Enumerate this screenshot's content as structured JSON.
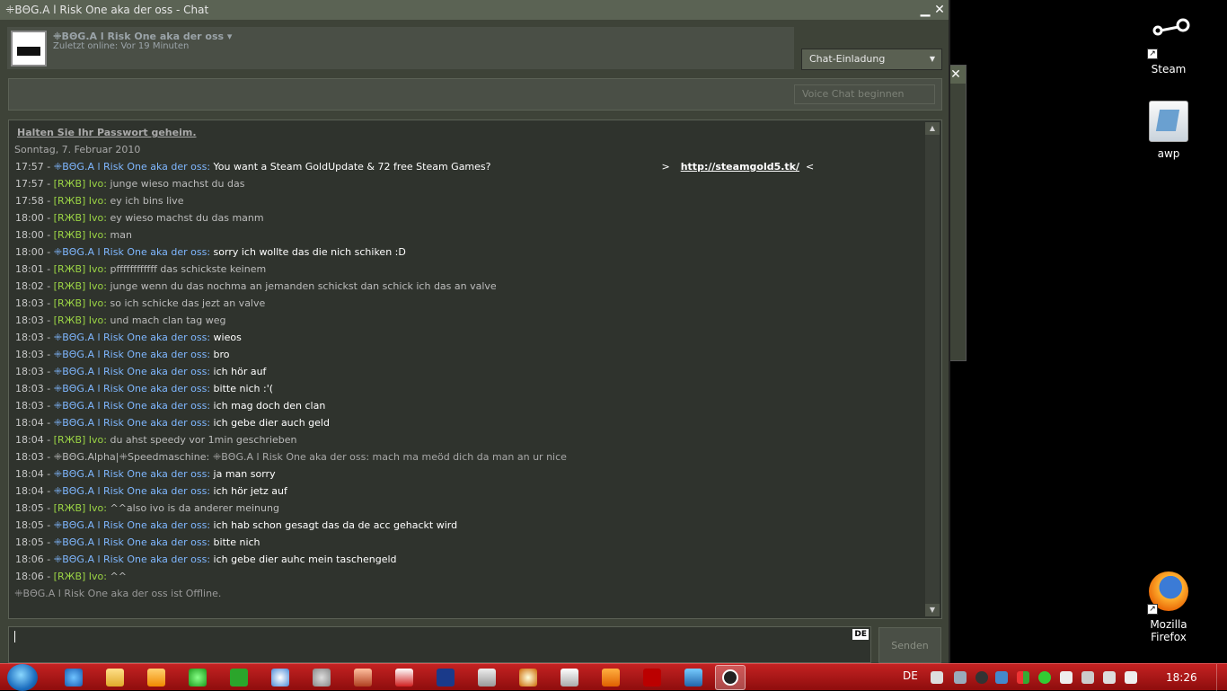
{
  "window": {
    "title": "ꔰBΘG.A l Risk One aka der oss - Chat",
    "minimize_glyph": "▁",
    "close_glyph": "✕"
  },
  "header": {
    "name": "ꔰBΘG.A l Risk One aka der oss ▾",
    "status": "Zuletzt online: Vor 19 Minuten"
  },
  "invite": {
    "label": "Chat-Einladung",
    "arrow": "▼"
  },
  "voice": {
    "label": "Voice Chat beginnen"
  },
  "log": {
    "warning": "Halten Sie Ihr Passwort geheim.",
    "date": "Sonntag, 7. Februar 2010",
    "messages": [
      {
        "time": "17:57 - ",
        "name": "ꔰBΘG.A l Risk One aka der oss",
        "sender": "self",
        "text": "You want a Steam GoldUpdate & 72 free Steam Games?",
        "link_prefix": ">",
        "link": "http://steamgold5.tk/",
        "link_suffix": "<"
      },
      {
        "time": "17:57 - ",
        "name": "[RЖB] Ivo",
        "sender": "ivo",
        "text": "junge wieso machst du das"
      },
      {
        "time": "17:58 - ",
        "name": "[RЖB] Ivo",
        "sender": "ivo",
        "text": "ey ich bins live"
      },
      {
        "time": "18:00 - ",
        "name": "[RЖB] Ivo",
        "sender": "ivo",
        "text": "ey wieso machst du das manm"
      },
      {
        "time": "18:00 - ",
        "name": "[RЖB] Ivo",
        "sender": "ivo",
        "text": "man"
      },
      {
        "time": "18:00 - ",
        "name": "ꔰBΘG.A l Risk One aka der oss",
        "sender": "self",
        "text": "sorry ich wollte das die nich schiken :D"
      },
      {
        "time": "18:01 - ",
        "name": "[RЖB] Ivo",
        "sender": "ivo",
        "text": "pffffffffffff das schickste keinem"
      },
      {
        "time": "18:02 - ",
        "name": "[RЖB] Ivo",
        "sender": "ivo",
        "text": "junge wenn du das nochma an jemanden schickst dan schick ich das an valve"
      },
      {
        "time": "18:03 - ",
        "name": "[RЖB] Ivo",
        "sender": "ivo",
        "text": "so ich schicke das jezt an valve"
      },
      {
        "time": "18:03 - ",
        "name": "[RЖB] Ivo",
        "sender": "ivo",
        "text": "und mach clan tag weg"
      },
      {
        "time": "18:03 - ",
        "name": "ꔰBΘG.A l Risk One aka der oss",
        "sender": "self",
        "text": "wieos"
      },
      {
        "time": "18:03 - ",
        "name": "ꔰBΘG.A l Risk One aka der oss",
        "sender": "self",
        "text": "bro"
      },
      {
        "time": "18:03 - ",
        "name": "ꔰBΘG.A l Risk One aka der oss",
        "sender": "self",
        "text": "ich hör auf"
      },
      {
        "time": "18:03 - ",
        "name": "ꔰBΘG.A l Risk One aka der oss",
        "sender": "self",
        "text": "bitte nich :'("
      },
      {
        "time": "18:03 - ",
        "name": "ꔰBΘG.A l Risk One aka der oss",
        "sender": "self",
        "text": "ich mag doch den clan"
      },
      {
        "time": "18:04 - ",
        "name": "ꔰBΘG.A l Risk One aka der oss",
        "sender": "self",
        "text": "ich gebe dier auch geld"
      },
      {
        "time": "18:04 - ",
        "name": "[RЖB] Ivo",
        "sender": "ivo",
        "text": "du ahst speedy vor 1min geschrieben"
      },
      {
        "time": "18:03 - ",
        "name": "ꔰBΘG.Alpha|ꔰSpeedmaschine",
        "sender": "other",
        "text": "ꔰBΘG.A l Risk One aka der oss: mach ma meöd dich da man an ur nice"
      },
      {
        "time": "18:04 - ",
        "name": "ꔰBΘG.A l Risk One aka der oss",
        "sender": "self",
        "text": "ja man sorry"
      },
      {
        "time": "18:04 - ",
        "name": "ꔰBΘG.A l Risk One aka der oss",
        "sender": "self",
        "text": "ich hör jetz auf"
      },
      {
        "time": "18:05 - ",
        "name": "[RЖB] Ivo",
        "sender": "ivo",
        "text": "^^also ivo is da anderer meinung"
      },
      {
        "time": "18:05 - ",
        "name": "ꔰBΘG.A l Risk One aka der oss",
        "sender": "self",
        "text": "ich hab schon gesagt das da de acc gehackt wird"
      },
      {
        "time": "18:05 - ",
        "name": "ꔰBΘG.A l Risk One aka der oss",
        "sender": "self",
        "text": "bitte nich"
      },
      {
        "time": "18:06 - ",
        "name": "ꔰBΘG.A l Risk One aka der oss",
        "sender": "self",
        "text": "ich gebe dier auhc mein taschengeld"
      },
      {
        "time": "18:06 - ",
        "name": "[RЖB] Ivo",
        "sender": "ivo",
        "text": "^^"
      }
    ],
    "offline_notice": "ꔰBΘG.A l Risk One aka der oss ist Offline.",
    "scroll_up": "▲",
    "scroll_down": "▼"
  },
  "input": {
    "lang_badge": "DE",
    "send_label": "Senden"
  },
  "desktop": {
    "icons": [
      {
        "label": "Steam",
        "icon": "steam-icon"
      },
      {
        "label": "awp",
        "icon": "file-icon"
      },
      {
        "label": "Mozilla Firefox",
        "icon": "firefox-icon"
      }
    ],
    "shortcut_glyph": "↗"
  },
  "taskbar": {
    "tray_lang": "DE",
    "clock": "18:26"
  }
}
